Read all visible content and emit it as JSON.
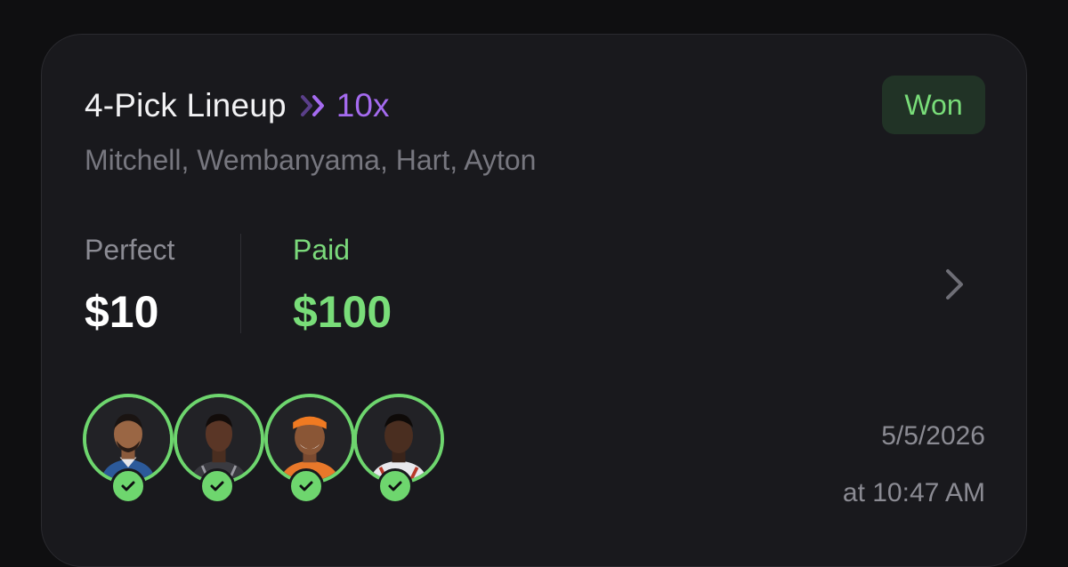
{
  "lineup": {
    "title": "4-Pick Lineup",
    "multiplier": "10x",
    "players": "Mitchell, Wembanyama, Hart, Ayton",
    "status": "Won"
  },
  "stats": {
    "perfect_label": "Perfect",
    "perfect_value": "$10",
    "paid_label": "Paid",
    "paid_value": "$100"
  },
  "date": {
    "day": "5/5/2026",
    "time": "at 10:47 AM"
  },
  "colors": {
    "accent_purple": "#a56bf0",
    "win_green": "#79dd79",
    "badge_bg": "#213326"
  }
}
